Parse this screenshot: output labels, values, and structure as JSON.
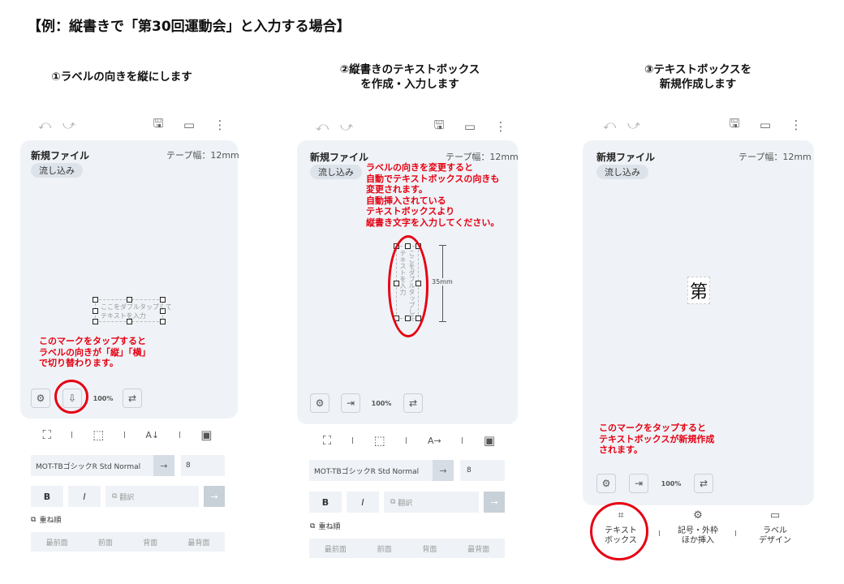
{
  "page_title": "【例：縦書きで「第30回運動会」と入力する場合】",
  "steps": [
    {
      "title_lines": [
        "①ラベルの向きを縦にします"
      ],
      "toolbar": {
        "undo_icon": "undo-icon",
        "redo_icon": "redo-icon",
        "save_icon": "save-icon",
        "template_icon": "template-icon",
        "menu_icon": "more-vert-icon"
      },
      "file_name": "新規ファイル",
      "tape_width": "テープ幅：12mm",
      "chip": "流し込み",
      "placeholder_lines": [
        "ここをダブルタップして",
        "テキストを入力"
      ],
      "note_lines": [
        "このマークをタップすると",
        "ラベルの向きが「縦」「横」",
        "で切り替わります。"
      ],
      "zoom_label": "100%",
      "font_name": "MOT-TBゴシックR Std Normal",
      "font_size": "8",
      "bold_label": "B",
      "italic_label": "I",
      "translate_label": "翻訳",
      "order_label": "重ね順",
      "order_items": [
        "最前面",
        "前面",
        "背面",
        "最背面"
      ],
      "arrow": "→"
    },
    {
      "title_lines": [
        "②縦書きのテキストボックス",
        "を作成・入力します"
      ],
      "file_name": "新規ファイル",
      "tape_width": "テープ幅：12mm",
      "chip": "流し込み",
      "note_lines": [
        "ラベルの向きを変更すると",
        "自動でテキストボックスの向きも",
        "変更されます。",
        "自動挿入されている",
        "テキストボックスより",
        "縦書き文字を入力してください。"
      ],
      "placeholder_lines": [
        "ここをダブルタップして",
        "テキストを入力"
      ],
      "dimension_label": "35mm",
      "zoom_label": "100%",
      "font_name": "MOT-TBゴシックR Std Normal",
      "font_size": "8",
      "bold_label": "B",
      "italic_label": "I",
      "translate_label": "翻訳",
      "order_label": "重ね順",
      "order_items": [
        "最前面",
        "前面",
        "背面",
        "最背面"
      ],
      "arrow": "→"
    },
    {
      "title_lines": [
        "③テキストボックスを",
        "新規作成します"
      ],
      "file_name": "新規ファイル",
      "tape_width": "テープ幅：12mm",
      "chip": "流し込み",
      "label_text": "第",
      "note_lines": [
        "このマークをタップすると",
        "テキストボックスが新規作成",
        "されます。"
      ],
      "zoom_label": "100%",
      "nav": [
        {
          "icon": "text-box-icon",
          "lines": [
            "テキスト",
            "ボックス"
          ]
        },
        {
          "icon": "symbol-icon",
          "lines": [
            "記号・外枠",
            "ほか挿入"
          ]
        },
        {
          "icon": "label-design-icon",
          "lines": [
            "ラベル",
            "デザイン"
          ]
        }
      ]
    }
  ],
  "colors": {
    "accent_red": "#e60012",
    "panel": "#eff3f7"
  }
}
